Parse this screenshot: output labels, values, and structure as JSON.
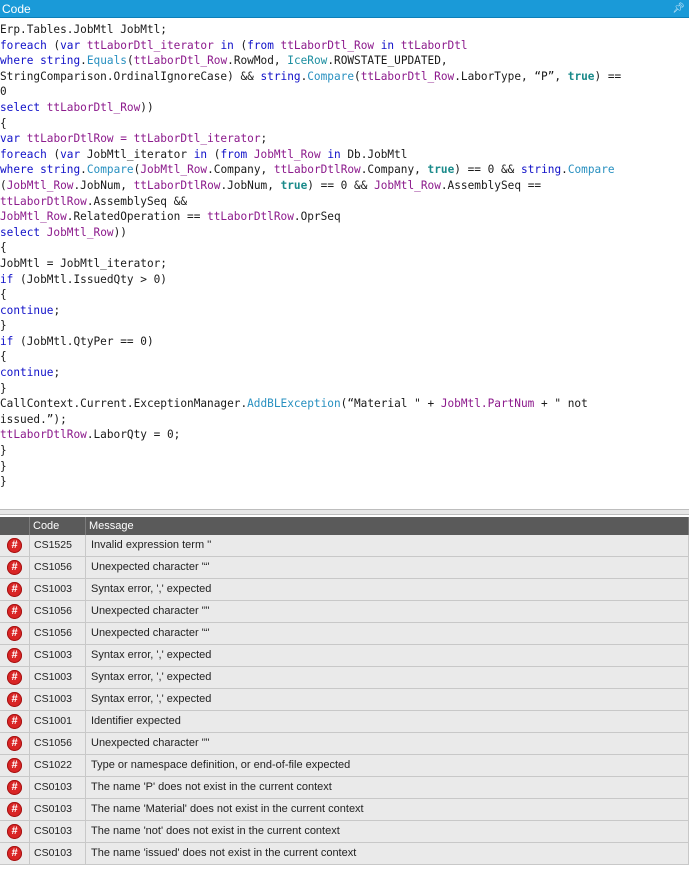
{
  "panel": {
    "title": "Code",
    "pin_icon": "pin-icon"
  },
  "code_lines": [
    [
      {
        "t": "Erp.Tables.JobMtl JobMtl;",
        "c": ""
      }
    ],
    [
      {
        "t": "foreach",
        "c": "kw"
      },
      {
        "t": " (",
        "c": ""
      },
      {
        "t": "var",
        "c": "kw"
      },
      {
        "t": " ttLaborDtl_iterator ",
        "c": "vr"
      },
      {
        "t": "in",
        "c": "kw"
      },
      {
        "t": " (",
        "c": ""
      },
      {
        "t": "from",
        "c": "kw"
      },
      {
        "t": " ttLaborDtl_Row ",
        "c": "vr"
      },
      {
        "t": "in",
        "c": "kw"
      },
      {
        "t": " ttLaborDtl",
        "c": "vr"
      }
    ],
    [
      {
        "t": "where",
        "c": "kw"
      },
      {
        "t": " ",
        "c": ""
      },
      {
        "t": "string",
        "c": "kw"
      },
      {
        "t": ".",
        "c": ""
      },
      {
        "t": "Equals",
        "c": "mt"
      },
      {
        "t": "(",
        "c": ""
      },
      {
        "t": "ttLaborDtl_Row",
        "c": "vr"
      },
      {
        "t": ".RowMod, ",
        "c": ""
      },
      {
        "t": "IceRow",
        "c": "ty"
      },
      {
        "t": ".ROWSTATE_UPDATED,",
        "c": ""
      }
    ],
    [
      {
        "t": "StringComparison.OrdinalIgnoreCase) && ",
        "c": ""
      },
      {
        "t": "string",
        "c": "kw"
      },
      {
        "t": ".",
        "c": ""
      },
      {
        "t": "Compare",
        "c": "mt"
      },
      {
        "t": "(",
        "c": ""
      },
      {
        "t": "ttLaborDtl_Row",
        "c": "vr"
      },
      {
        "t": ".LaborType, “P”, ",
        "c": ""
      },
      {
        "t": "true",
        "c": "bt"
      },
      {
        "t": ") ==",
        "c": ""
      }
    ],
    [
      {
        "t": "0",
        "c": ""
      }
    ],
    [
      {
        "t": "select",
        "c": "kw"
      },
      {
        "t": " ttLaborDtl_Row",
        "c": "vr"
      },
      {
        "t": "))",
        "c": ""
      }
    ],
    [
      {
        "t": "{",
        "c": ""
      }
    ],
    [
      {
        "t": "var",
        "c": "kw"
      },
      {
        "t": " ttLaborDtlRow = ",
        "c": "vr"
      },
      {
        "t": "ttLaborDtl_iterator",
        "c": "vr"
      },
      {
        "t": ";",
        "c": ""
      }
    ],
    [
      {
        "t": "foreach",
        "c": "kw"
      },
      {
        "t": " (",
        "c": ""
      },
      {
        "t": "var",
        "c": "kw"
      },
      {
        "t": " JobMtl_iterator ",
        "c": ""
      },
      {
        "t": "in",
        "c": "kw"
      },
      {
        "t": " (",
        "c": ""
      },
      {
        "t": "from",
        "c": "kw"
      },
      {
        "t": " JobMtl_Row ",
        "c": "vr"
      },
      {
        "t": "in",
        "c": "kw"
      },
      {
        "t": " Db.JobMtl",
        "c": ""
      }
    ],
    [
      {
        "t": "where",
        "c": "kw"
      },
      {
        "t": " ",
        "c": ""
      },
      {
        "t": "string",
        "c": "kw"
      },
      {
        "t": ".",
        "c": ""
      },
      {
        "t": "Compare",
        "c": "mt"
      },
      {
        "t": "(",
        "c": ""
      },
      {
        "t": "JobMtl_Row",
        "c": "vr"
      },
      {
        "t": ".Company, ",
        "c": ""
      },
      {
        "t": "ttLaborDtlRow",
        "c": "vr"
      },
      {
        "t": ".Company, ",
        "c": ""
      },
      {
        "t": "true",
        "c": "bt"
      },
      {
        "t": ") == 0 && ",
        "c": ""
      },
      {
        "t": "string",
        "c": "kw"
      },
      {
        "t": ".",
        "c": ""
      },
      {
        "t": "Compare",
        "c": "mt"
      }
    ],
    [
      {
        "t": "(",
        "c": ""
      },
      {
        "t": "JobMtl_Row",
        "c": "vr"
      },
      {
        "t": ".JobNum, ",
        "c": ""
      },
      {
        "t": "ttLaborDtlRow",
        "c": "vr"
      },
      {
        "t": ".JobNum, ",
        "c": ""
      },
      {
        "t": "true",
        "c": "bt"
      },
      {
        "t": ") == 0 && ",
        "c": ""
      },
      {
        "t": "JobMtl_Row",
        "c": "vr"
      },
      {
        "t": ".AssemblySeq ==",
        "c": ""
      }
    ],
    [
      {
        "t": "ttLaborDtlRow",
        "c": "vr"
      },
      {
        "t": ".AssemblySeq &&",
        "c": ""
      }
    ],
    [
      {
        "t": "JobMtl_Row",
        "c": "vr"
      },
      {
        "t": ".RelatedOperation == ",
        "c": ""
      },
      {
        "t": "ttLaborDtlRow",
        "c": "vr"
      },
      {
        "t": ".OprSeq",
        "c": ""
      }
    ],
    [
      {
        "t": "select",
        "c": "kw"
      },
      {
        "t": " JobMtl_Row",
        "c": "vr"
      },
      {
        "t": "))",
        "c": ""
      }
    ],
    [
      {
        "t": "{",
        "c": ""
      }
    ],
    [
      {
        "t": "JobMtl = JobMtl_iterator;",
        "c": ""
      }
    ],
    [
      {
        "t": "if",
        "c": "kw"
      },
      {
        "t": " (JobMtl.IssuedQty > 0)",
        "c": ""
      }
    ],
    [
      {
        "t": "{",
        "c": ""
      }
    ],
    [
      {
        "t": "continue",
        "c": "kw"
      },
      {
        "t": ";",
        "c": ""
      }
    ],
    [
      {
        "t": "}",
        "c": ""
      }
    ],
    [
      {
        "t": "if",
        "c": "kw"
      },
      {
        "t": " (JobMtl.QtyPer == 0)",
        "c": ""
      }
    ],
    [
      {
        "t": "{",
        "c": ""
      }
    ],
    [
      {
        "t": "continue",
        "c": "kw"
      },
      {
        "t": ";",
        "c": ""
      }
    ],
    [
      {
        "t": "}",
        "c": ""
      }
    ],
    [
      {
        "t": "CallContext.Current.ExceptionManager.",
        "c": ""
      },
      {
        "t": "AddBLException",
        "c": "mt"
      },
      {
        "t": "(“Material \" + ",
        "c": ""
      },
      {
        "t": "JobMtl.PartNum",
        "c": "vr"
      },
      {
        "t": " + \" not",
        "c": ""
      }
    ],
    [
      {
        "t": "issued.”);",
        "c": ""
      }
    ],
    [
      {
        "t": "ttLaborDtlRow",
        "c": "vr"
      },
      {
        "t": ".LaborQty = 0;",
        "c": ""
      }
    ],
    [
      {
        "t": "}",
        "c": ""
      }
    ],
    [
      {
        "t": "}",
        "c": ""
      }
    ],
    [
      {
        "t": "}",
        "c": ""
      }
    ]
  ],
  "errors": {
    "headers": {
      "icon": "",
      "code": "Code",
      "message": "Message"
    },
    "error_icon": "error-hash-icon",
    "error_glyph": "#",
    "rows": [
      {
        "code": "CS1525",
        "message": "Invalid expression term ''"
      },
      {
        "code": "CS1056",
        "message": "Unexpected character '“'"
      },
      {
        "code": "CS1003",
        "message": "Syntax error, ',' expected"
      },
      {
        "code": "CS1056",
        "message": "Unexpected character '”'"
      },
      {
        "code": "CS1056",
        "message": "Unexpected character '“'"
      },
      {
        "code": "CS1003",
        "message": "Syntax error, ',' expected"
      },
      {
        "code": "CS1003",
        "message": "Syntax error, ',' expected"
      },
      {
        "code": "CS1003",
        "message": "Syntax error, ',' expected"
      },
      {
        "code": "CS1001",
        "message": "Identifier expected"
      },
      {
        "code": "CS1056",
        "message": "Unexpected character '”'"
      },
      {
        "code": "CS1022",
        "message": "Type or namespace definition, or end-of-file expected"
      },
      {
        "code": "CS0103",
        "message": "The name 'P' does not exist in the current context"
      },
      {
        "code": "CS0103",
        "message": "The name 'Material' does not exist in the current context"
      },
      {
        "code": "CS0103",
        "message": "The name 'not' does not exist in the current context"
      },
      {
        "code": "CS0103",
        "message": "The name 'issued' does not exist in the current context"
      }
    ]
  }
}
